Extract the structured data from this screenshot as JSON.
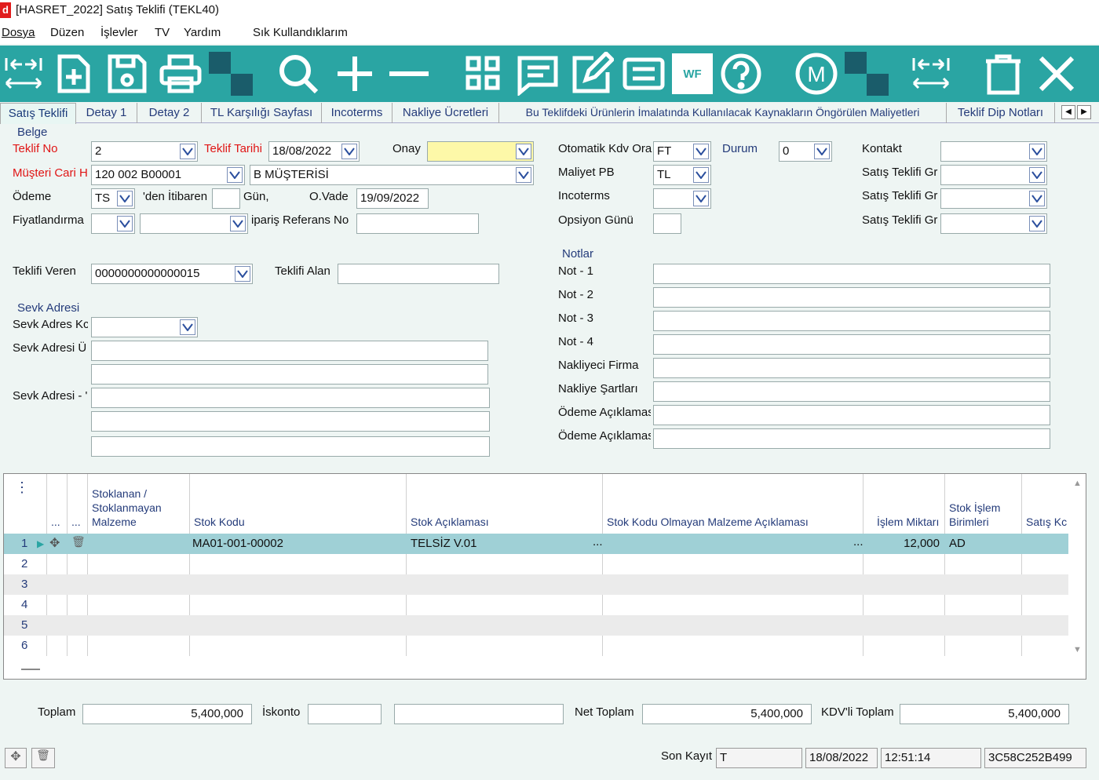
{
  "window": {
    "title": "[HASRET_2022] Satış Teklifi (TEKL40)",
    "icon": "d"
  },
  "menu": [
    "Dosya",
    "Düzen",
    "İşlevler",
    "TV",
    "Yardım",
    "Sık Kullandıklarım"
  ],
  "toolbar": {
    "icons": [
      "first-last-nav-icon",
      "new-document-icon",
      "save-icon",
      "print-icon",
      "checker-icon",
      "search-icon",
      "plus-icon",
      "minus-icon",
      "grid-icon",
      "message-icon",
      "edit-icon",
      "list-icon",
      "wf-icon",
      "help-icon",
      "m-icon",
      "checker-icon",
      "expand-icon",
      "delete-icon",
      "close-icon"
    ],
    "wf_label": "WF",
    "m_label": "M"
  },
  "tabs": [
    "Satış Teklifi",
    "Detay 1",
    "Detay 2",
    "TL Karşılığı Sayfası",
    "Incoterms",
    "Nakliye Ücretleri",
    "Bu Teklifdeki Ürünlerin İmalatında Kullanılacak Kaynakların Öngörülen Maliyetleri",
    "Teklif Dip Notları"
  ],
  "belge": {
    "section": "Belge",
    "teklif_no_label": "Teklif No",
    "teklif_no": "2",
    "teklif_tarihi_label": "Teklif Tarihi",
    "teklif_tarihi": "18/08/2022",
    "onay_label": "Onay",
    "onay": "",
    "musteri_label": "Müşteri Cari He",
    "musteri_kod": "120 002 B00001",
    "musteri_ad": "B MÜŞTERİSİ",
    "odeme_label": "Ödeme",
    "odeme": "TS",
    "den_itibaren": "'den İtibaren",
    "gun": "",
    "gun_label": "Gün,",
    "ovade_label": "O.Vade",
    "ovade": "19/09/2022",
    "fiyat_label": "Fiyatlandırma",
    "fiyat1": "",
    "fiyat2": "",
    "siparis_label": "ipariş Referans No",
    "siparis": "",
    "teklifi_veren_label": "Teklifi Veren",
    "teklifi_veren": "0000000000000015",
    "teklifi_alan_label": "Teklifi Alan",
    "teklifi_alan": ""
  },
  "right": {
    "otomatik_label": "Otomatik Kdv Ora",
    "otomatik": "FT",
    "durum_label": "Durum",
    "durum": "0",
    "kontakt_label": "Kontakt",
    "kontakt": "",
    "maliyet_label": "Maliyet PB",
    "maliyet": "TL",
    "incoterms_label": "Incoterms",
    "incoterms": "",
    "opsiyon_label": "Opsiyon Günü",
    "opsiyon": "",
    "satis_gr_label": "Satış Teklifi Gr"
  },
  "sevk": {
    "section": "Sevk Adresi",
    "kod_label": "Sevk Adres Kc",
    "u_label": "Sevk Adresi Ü",
    "alt_label": "Sevk Adresi - '"
  },
  "notlar": {
    "section": "Notlar",
    "labels": [
      "Not - 1",
      "Not - 2",
      "Not - 3",
      "Not - 4",
      "Nakliyeci Firma",
      "Nakliye Şartları",
      "Ödeme Açıklamas",
      "Ödeme Açıklamas"
    ]
  },
  "grid": {
    "menu_glyph": "⋮",
    "dots": "...",
    "headers": {
      "stoklanan": "Stoklanan / Stoklanmayan Malzeme",
      "stok_kodu": "Stok Kodu",
      "stok_aciklama": "Stok Açıklaması",
      "stok_kodu_olmayan": "Stok Kodu Olmayan Malzeme Açıklaması",
      "islem_miktari": "İşlem Miktarı",
      "stok_islem_birimleri": "Stok İşlem Birimleri",
      "satis_kodu": "Satış Kc"
    },
    "rows": [
      {
        "no": "1",
        "stok_kodu": "MA01-001-00002",
        "aciklama": "TELSİZ V.01",
        "miktar": "12,000",
        "birim": "AD"
      },
      {
        "no": "2"
      },
      {
        "no": "3"
      },
      {
        "no": "4"
      },
      {
        "no": "5"
      },
      {
        "no": "6"
      }
    ]
  },
  "totals": {
    "toplam_label": "Toplam",
    "toplam": "5,400,000",
    "iskonto_label": "İskonto",
    "iskonto": "",
    "iskonto2": "",
    "net_label": "Net Toplam",
    "net": "5,400,000",
    "kdv_label": "KDV'li Toplam",
    "kdv": "5,400,000"
  },
  "status": {
    "son_kayit_label": "Son Kayıt",
    "user": "T",
    "date": "18/08/2022",
    "time": "12:51:14",
    "code": "3C58C252B499"
  },
  "colors": {
    "toolbar": "#2aa5a3",
    "accent_red": "#e01515",
    "row_selected": "#9fd0d6",
    "onay_yellow": "#fdf8a8"
  }
}
